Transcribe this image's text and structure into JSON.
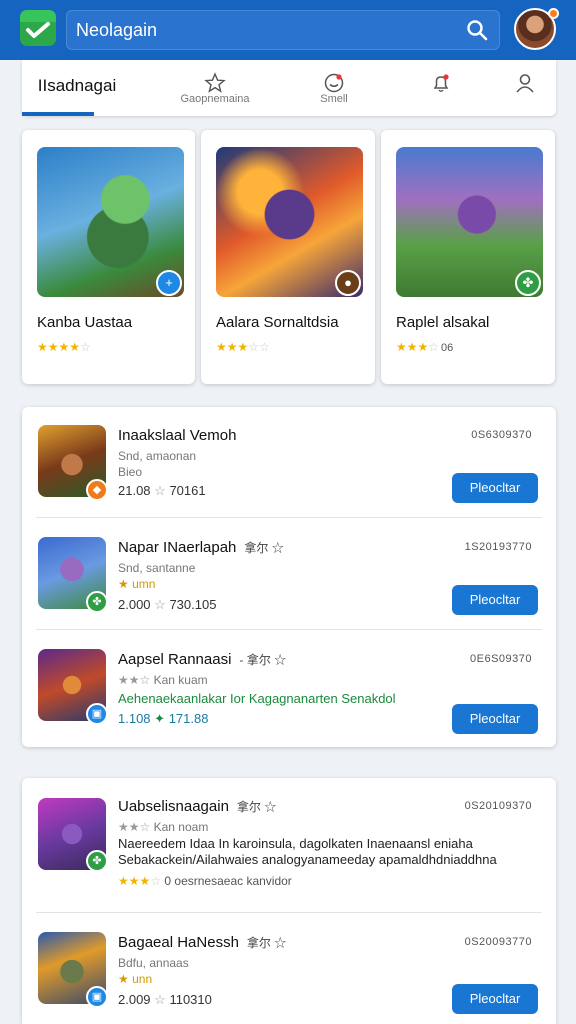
{
  "appbar": {
    "search_text": "Neolagain"
  },
  "tabs": [
    {
      "label": "IIsadnagai",
      "icon": "home-icon"
    },
    {
      "label": "Gaopnemaina",
      "icon": "star-icon"
    },
    {
      "label": "Smell",
      "icon": "smile-icon"
    },
    {
      "label": "",
      "icon": "bell-icon"
    },
    {
      "label": "",
      "icon": "user-icon"
    }
  ],
  "featured": [
    {
      "title": "Kanba Uastaa",
      "rating": 4,
      "rating_text": "",
      "badge_color": "#1e88e5",
      "badge_icon": "plus-icon"
    },
    {
      "title": "Aalara Sornaltdsia",
      "rating": 3,
      "rating_text": "",
      "badge_color": "#6b3e1a",
      "badge_icon": "paw-icon"
    },
    {
      "title": "Raplel alsakal",
      "rating": 3,
      "rating_text": "06",
      "badge_color": "#2e9e44",
      "badge_icon": "clover-icon"
    }
  ],
  "list1": [
    {
      "title": "Inaakslaal Vemoh",
      "tag": "",
      "sub1": "Snd, amaonan",
      "sub2": "Bieo",
      "meta": "21.08",
      "meta2": "70161",
      "code": "0S6309370",
      "button": "Pleocltar",
      "badge_color": "#ef7c1a"
    },
    {
      "title": "Napar INaerlapah",
      "tag": "拿尔 ☆",
      "sub1": "Snd, santanne",
      "sub2": "★ umn",
      "meta": "2.000",
      "meta2": "730.105",
      "code": "1S20193770",
      "button": "Pleocltar",
      "badge_color": "#2e9e44"
    },
    {
      "title": "Aapsel Rannaasi",
      "tag": "- 拿尔 ☆",
      "sub1": "Kan kuam",
      "sub2": "Aehenaekaanlakar Ior Kagagnanarten Senakdol",
      "meta": "1.108",
      "meta2": "171.88",
      "code": "0E6S09370",
      "button": "Pleocltar",
      "badge_color": "#1e88e5"
    }
  ],
  "list2": [
    {
      "title": "Uabselisnaagain",
      "tag": "拿尔 ☆",
      "sub1": "Kan noam",
      "desc1": "Naereedem Idaa In karoinsula, dagolkaten Inaenaansl eniaha",
      "desc2": "Sebakackein/Ailahwaies analogyanameeday apamaldhdniaddhna",
      "meta": "0 oesrnesaeac kanvidor",
      "code": "0S20109370",
      "badge_color": "#2e9e44"
    },
    {
      "title": "Bagaeal HaNessh",
      "tag": "拿尔 ☆",
      "sub1": "Bdfu, annaas",
      "sub2": "★ unn",
      "meta": "2.009",
      "meta2": "110310",
      "code": "0S20093770",
      "button": "Pleocltar",
      "badge_color": "#1e88e5"
    }
  ]
}
